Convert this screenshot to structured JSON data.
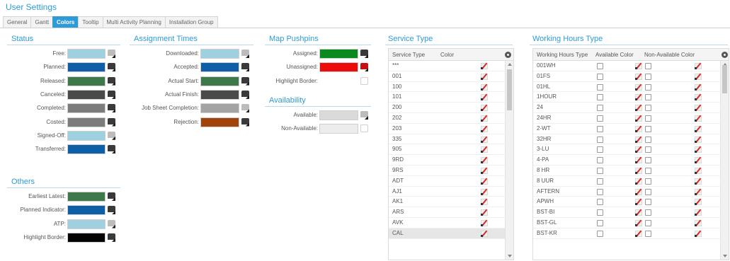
{
  "page": {
    "title": "User Settings"
  },
  "tabs": [
    {
      "label": "General",
      "active": false
    },
    {
      "label": "Gantt",
      "active": false
    },
    {
      "label": "Colors",
      "active": true
    },
    {
      "label": "Tooltip",
      "active": false
    },
    {
      "label": "Multi Activity Planning",
      "active": false
    },
    {
      "label": "Installation Group",
      "active": false
    }
  ],
  "status": {
    "title": "Status",
    "items": [
      {
        "label": "Free:",
        "color": "#9fd0e0",
        "picker": "light"
      },
      {
        "label": "Planned:",
        "color": "#0f5fa8",
        "picker": "dark"
      },
      {
        "label": "Released:",
        "color": "#3e7a49",
        "picker": "dark"
      },
      {
        "label": "Canceled:",
        "color": "#4a4a4a",
        "picker": "dark"
      },
      {
        "label": "Completed:",
        "color": "#7c7c7c",
        "picker": "dark"
      },
      {
        "label": "Costed:",
        "color": "#7c7c7c",
        "picker": "dark"
      },
      {
        "label": "Signed-Off:",
        "color": "#9fd0e0",
        "picker": "light"
      },
      {
        "label": "Transferred:",
        "color": "#0f5fa8",
        "picker": "dark"
      }
    ]
  },
  "others": {
    "title": "Others",
    "items": [
      {
        "label": "Earliest Latest:",
        "color": "#3e7a49",
        "picker": "dark"
      },
      {
        "label": "Planned Indicator:",
        "color": "#0f5fa8",
        "picker": "dark"
      },
      {
        "label": "ATP:",
        "color": "#9fd0e0",
        "picker": "light"
      },
      {
        "label": "Highlight Border:",
        "color": "#050505",
        "picker": "dark"
      }
    ]
  },
  "assignment": {
    "title": "Assignment Times",
    "items": [
      {
        "label": "Downloaded:",
        "color": "#9fd0e0",
        "picker": "light"
      },
      {
        "label": "Accepted:",
        "color": "#0f5fa8",
        "picker": "dark"
      },
      {
        "label": "Actual Start:",
        "color": "#3e7a49",
        "picker": "dark"
      },
      {
        "label": "Actual Finish:",
        "color": "#4a4a4a",
        "picker": "dark"
      },
      {
        "label": "Job Sheet Completion:",
        "color": "#a4a4a4",
        "picker": "light"
      },
      {
        "label": "Rejection:",
        "color": "#a0440b",
        "picker": "dark"
      }
    ]
  },
  "pushpins": {
    "title": "Map Pushpins",
    "items": [
      {
        "label": "Assigned:",
        "color": "#0a8a1e",
        "picker": "dark"
      },
      {
        "label": "Unassigned:",
        "color": "#ec0c0c",
        "picker": "red"
      },
      {
        "label": "Highlight Border:",
        "color": "",
        "picker": "blank"
      }
    ]
  },
  "availability": {
    "title": "Availability",
    "items": [
      {
        "label": "Available:",
        "color": "#dadada",
        "picker": "light"
      },
      {
        "label": "Non-Available:",
        "color": "#ececec",
        "picker": "blank"
      }
    ]
  },
  "service_type": {
    "title": "Service Type",
    "columns": [
      "Service Type",
      "Color"
    ],
    "rows": [
      "***",
      "001",
      "100",
      "101",
      "200",
      "202",
      "203",
      "335",
      "905",
      "9RD",
      "9RS",
      "ADT",
      "AJ1",
      "AK1",
      "ARS",
      "AVK",
      "CAL"
    ],
    "selected_row": 16
  },
  "working_hours": {
    "title": "Working Hours Type",
    "columns": [
      "Working Hours Type",
      "Available Color",
      "Non-Available Color"
    ],
    "rows": [
      "001WH",
      "01FS",
      "01HL",
      "1HOUR",
      "24",
      "24HR",
      "2-WT",
      "32HR",
      "3-LU",
      "4-PA",
      "8 HR",
      "8 UUR",
      "AFTERN",
      "APWH",
      "BST-BI",
      "BST-GL",
      "BST-KR"
    ]
  }
}
